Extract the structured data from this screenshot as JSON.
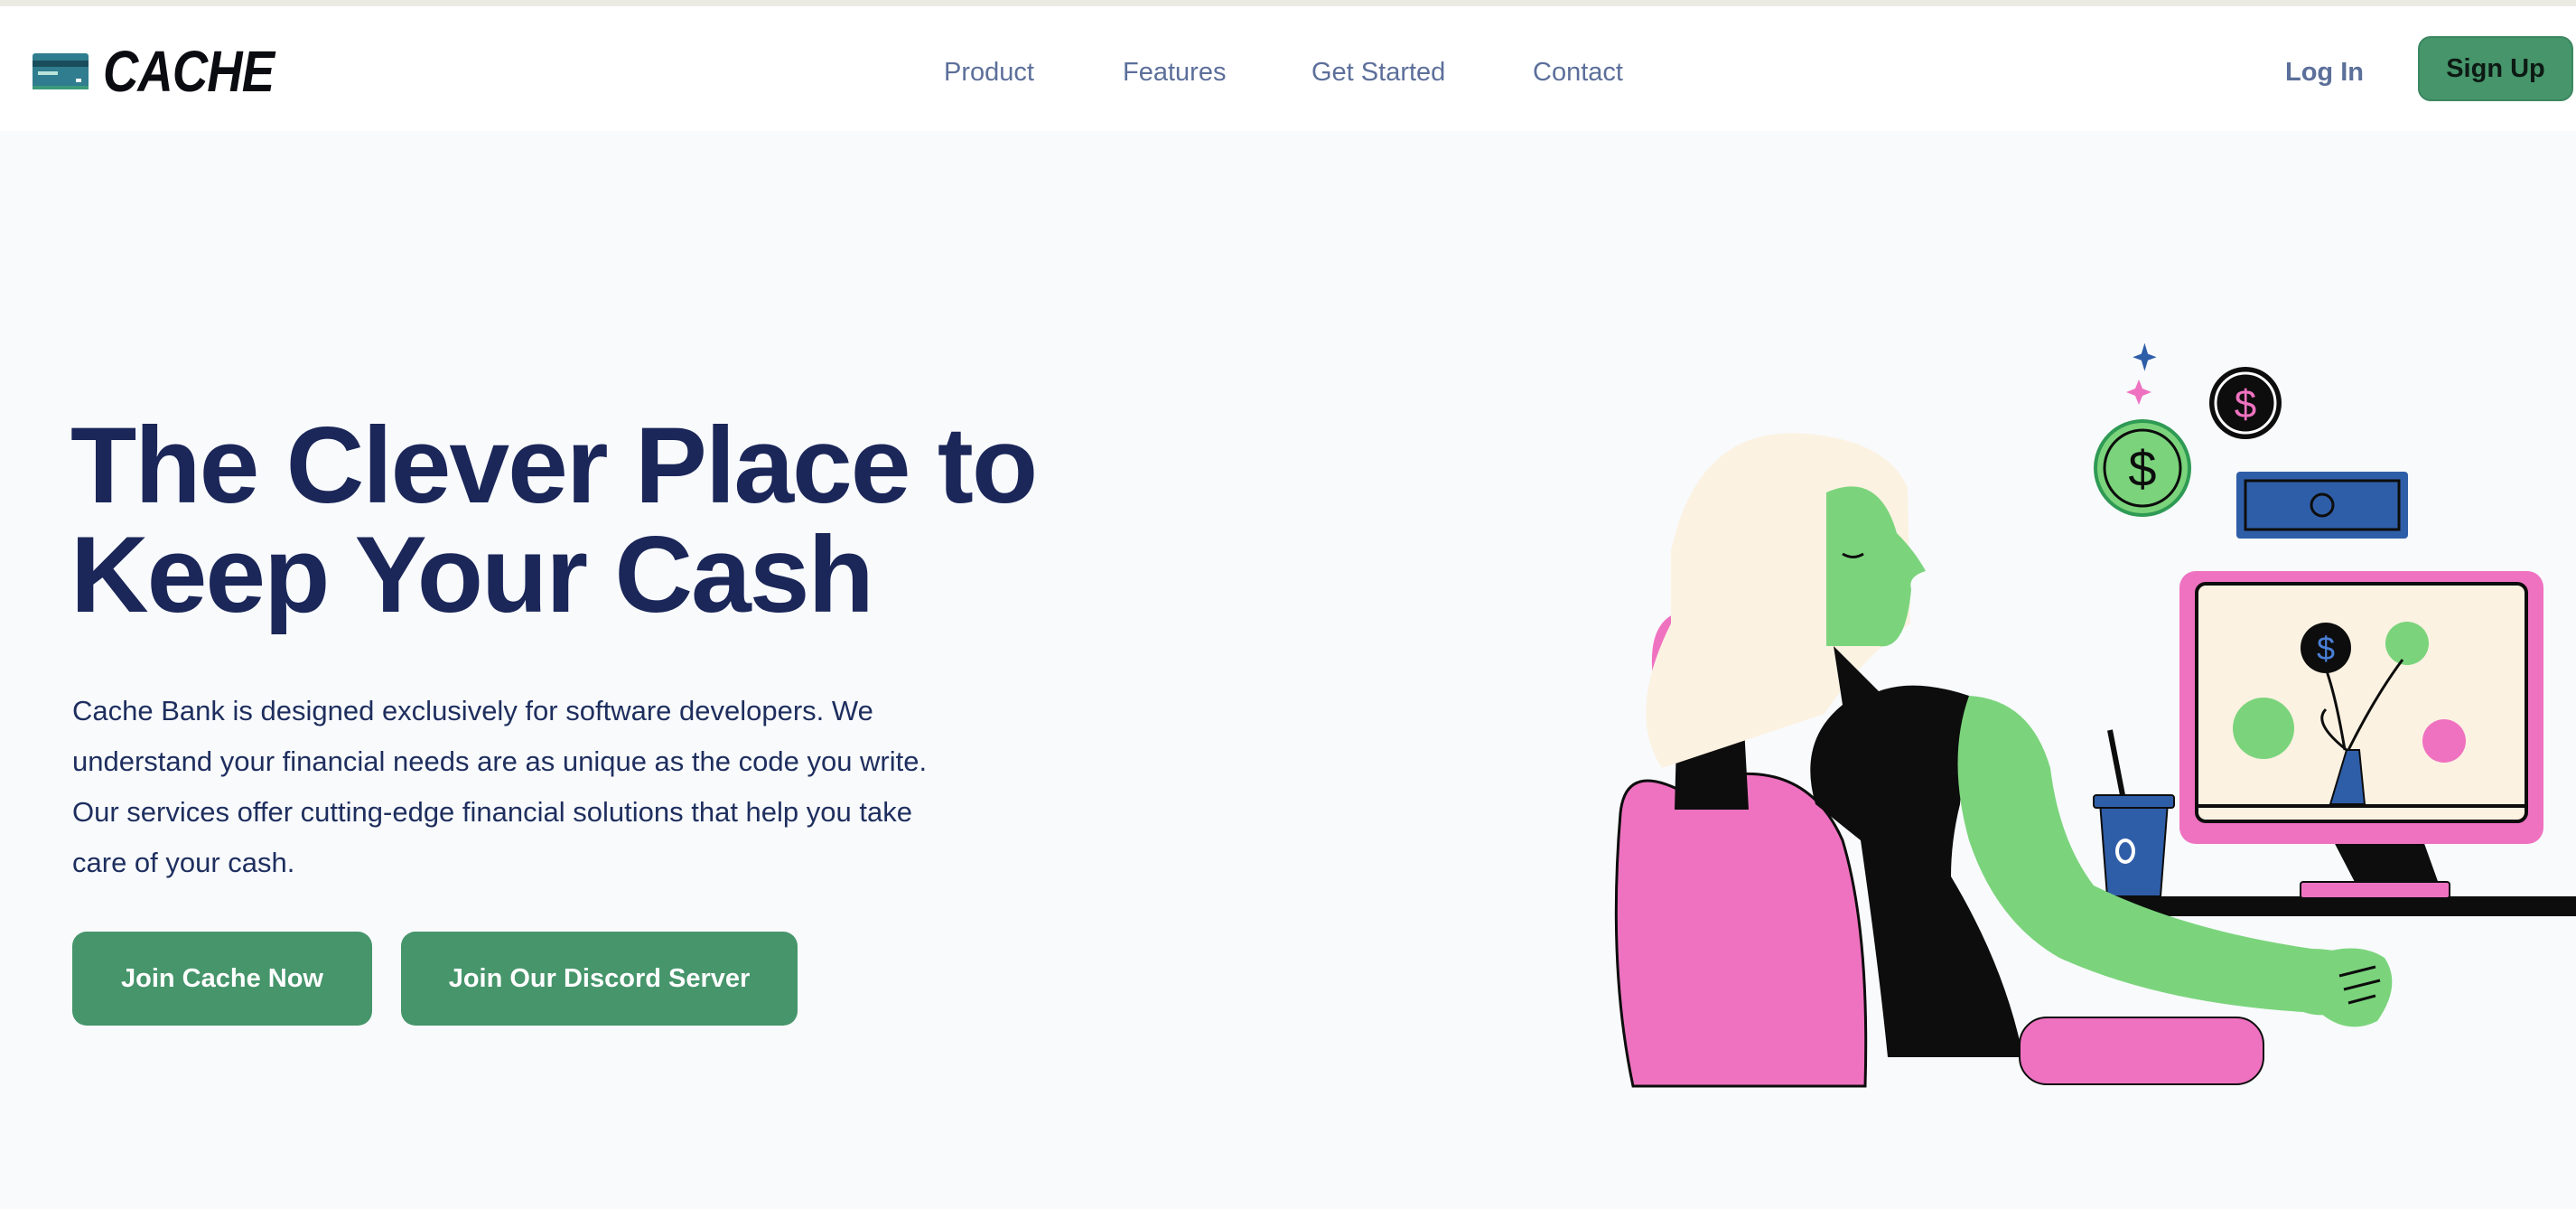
{
  "header": {
    "brand": "CACHE",
    "logo_icon": "credit-card-icon",
    "nav": [
      {
        "label": "Product"
      },
      {
        "label": "Features"
      },
      {
        "label": "Get Started"
      },
      {
        "label": "Contact"
      }
    ],
    "login_label": "Log In",
    "signup_label": "Sign Up"
  },
  "hero": {
    "title_line1": "The Clever Place to",
    "title_line2": "Keep Your Cash",
    "description_lines": [
      "Cache Bank is designed exclusively for software developers. We",
      "understand your financial needs are as unique as the code you write.",
      "Our services offer cutting-edge financial solutions that help you take",
      "care of your cash."
    ],
    "primary_button": "Join Cache Now",
    "secondary_button": "Join Our Discord Server"
  },
  "colors": {
    "accent": "#46956b",
    "heading": "#1b2659",
    "nav_text": "#5c6f9a",
    "background": "#f8fafc",
    "illustration_green": "#7bd47c",
    "illustration_pink": "#ef72c1",
    "illustration_blue": "#2f5ea8"
  }
}
